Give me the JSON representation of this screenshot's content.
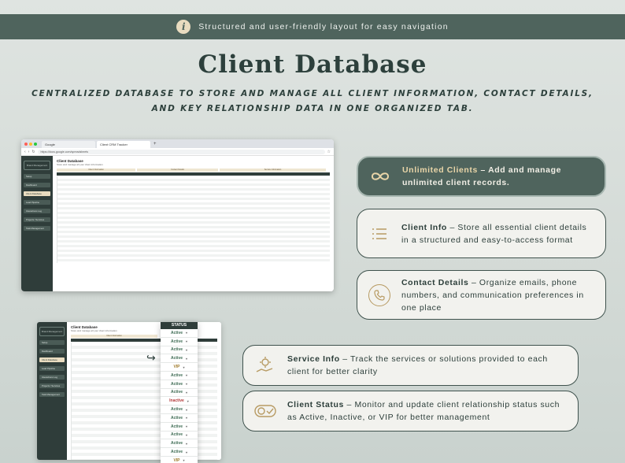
{
  "banner": {
    "text": "Structured and user-friendly layout for easy navigation",
    "icon": "info-icon"
  },
  "title": "Client Database",
  "subtitle_line1": "CENTRALIZED DATABASE TO STORE AND MANAGE ALL CLIENT INFORMATION, CONTACT DETAILS,",
  "subtitle_line2": "AND KEY RELATIONSHIP DATA IN ONE ORGANIZED TAB.",
  "browser": {
    "tab1": "Google",
    "tab2": "Client CRM Tracker",
    "new_tab": "+",
    "url": "https://docs.google.com/spreadsheets"
  },
  "sheet": {
    "title": "Client Database",
    "subtitle": "Store and manage all your client information",
    "logo_text": "Brand Management",
    "nav": [
      "Setup",
      "Dashboard",
      "Client Database",
      "Lead Pipeline",
      "Interactions Log",
      "Projects / Services",
      "Task Management"
    ],
    "groups": [
      "Client Information",
      "Contact Details",
      "Service Information"
    ]
  },
  "status_column": {
    "header": "STATUS",
    "values": [
      "Active",
      "Active",
      "Active",
      "Active",
      "VIP",
      "Active",
      "Active",
      "Active",
      "Inactive",
      "Active",
      "Active",
      "Active",
      "Active",
      "Active",
      "Active",
      "VIP"
    ]
  },
  "colors": {
    "active": "#3d6b53",
    "vip": "#a07b2c",
    "inactive": "#b43b3b",
    "accent": "#b79a62",
    "dark": "#4f645d"
  },
  "features": [
    {
      "title": "Unlimited Clients",
      "desc": "Add and manage unlimited client records.",
      "icon": "infinity-icon"
    },
    {
      "title": "Client Info",
      "desc": "Store all essential client details in a structured and easy-to-access format",
      "icon": "list-icon"
    },
    {
      "title": "Contact Details",
      "desc": "Organize emails, phone numbers, and communication preferences in one place",
      "icon": "phone-icon"
    },
    {
      "title": "Service Info",
      "desc": "Track the services or solutions provided to each client for better clarity",
      "icon": "hand-gear-icon"
    },
    {
      "title": "Client Status",
      "desc": "Monitor and update client relationship status such as Active, Inactive, or VIP for better management",
      "icon": "toggle-check-icon"
    }
  ],
  "dash": " – "
}
